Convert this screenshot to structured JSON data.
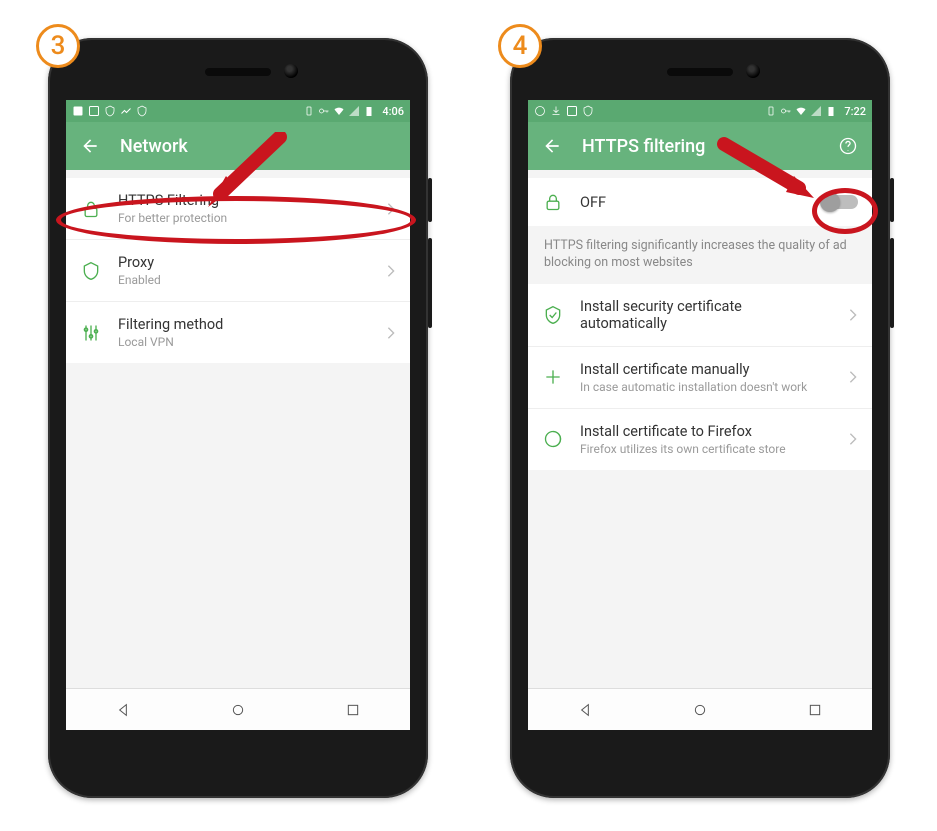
{
  "steps": {
    "left": "3",
    "right": "4"
  },
  "colors": {
    "accent": "#67b37d",
    "highlight": "#c9151e",
    "badge": "#ed8b1c"
  },
  "left": {
    "statusbar": {
      "time": "4:06"
    },
    "appbar": {
      "title": "Network"
    },
    "rows": [
      {
        "title": "HTTPS Filtering",
        "sub": "For better protection"
      },
      {
        "title": "Proxy",
        "sub": "Enabled"
      },
      {
        "title": "Filtering method",
        "sub": "Local VPN"
      }
    ]
  },
  "right": {
    "statusbar": {
      "time": "7:22"
    },
    "appbar": {
      "title": "HTTPS filtering"
    },
    "toggle": {
      "label": "OFF",
      "state": "off"
    },
    "description": "HTTPS filtering significantly increases the quality of ad blocking on most websites",
    "rows": [
      {
        "title": "Install security certificate automatically",
        "sub": ""
      },
      {
        "title": "Install certificate manually",
        "sub": "In case automatic installation doesn't work"
      },
      {
        "title": "Install certificate to Firefox",
        "sub": "Firefox utilizes its own certificate store"
      }
    ]
  }
}
